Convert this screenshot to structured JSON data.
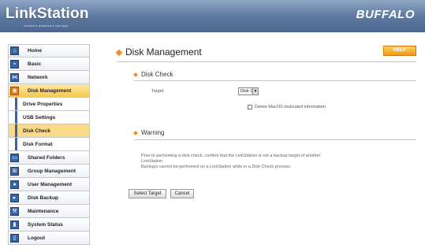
{
  "header": {
    "logo": "LinkStation",
    "tagline": "network attached storage",
    "brand": "BUFFALO"
  },
  "sidebar": {
    "items": [
      {
        "label": "Home",
        "icon": "home-icon"
      },
      {
        "label": "Basic",
        "icon": "basic-icon"
      },
      {
        "label": "Network",
        "icon": "network-icon"
      },
      {
        "label": "Disk Management",
        "icon": "disk-icon"
      },
      {
        "label": "Drive Properties"
      },
      {
        "label": "USB Settings"
      },
      {
        "label": "Disk Check"
      },
      {
        "label": "Disk Format"
      },
      {
        "label": "Shared Folders",
        "icon": "folder-icon"
      },
      {
        "label": "Group Management",
        "icon": "group-icon"
      },
      {
        "label": "User Management",
        "icon": "user-icon"
      },
      {
        "label": "Disk Backup",
        "icon": "backup-icon"
      },
      {
        "label": "Maintenance",
        "icon": "maintenance-icon"
      },
      {
        "label": "System Status",
        "icon": "status-icon"
      },
      {
        "label": "Logout",
        "icon": "logout-icon"
      }
    ]
  },
  "main": {
    "title": "Disk Management",
    "help_label": "HELP",
    "disk_check": {
      "heading": "Disk Check",
      "target_label": "Target",
      "target_value": "Disk 1",
      "delete_label": "Delete MacOS dedicated information",
      "delete_checked": false
    },
    "warning": {
      "heading": "Warning",
      "line1": "Prior to performing a disk check, confirm that the LinkStation is not a backup target of another",
      "line2": "LinkStation.",
      "line3": "Backups cannot be performed on a LinkStation while in a Disk Check process."
    },
    "buttons": {
      "select_target": "Select Target",
      "cancel": "Cancel"
    }
  },
  "colors": {
    "header_blue": "#5f7aa0",
    "accent_orange": "#f28c1a",
    "active_yellow": "#f6c94e",
    "nav_icon_blue": "#3763a7"
  }
}
